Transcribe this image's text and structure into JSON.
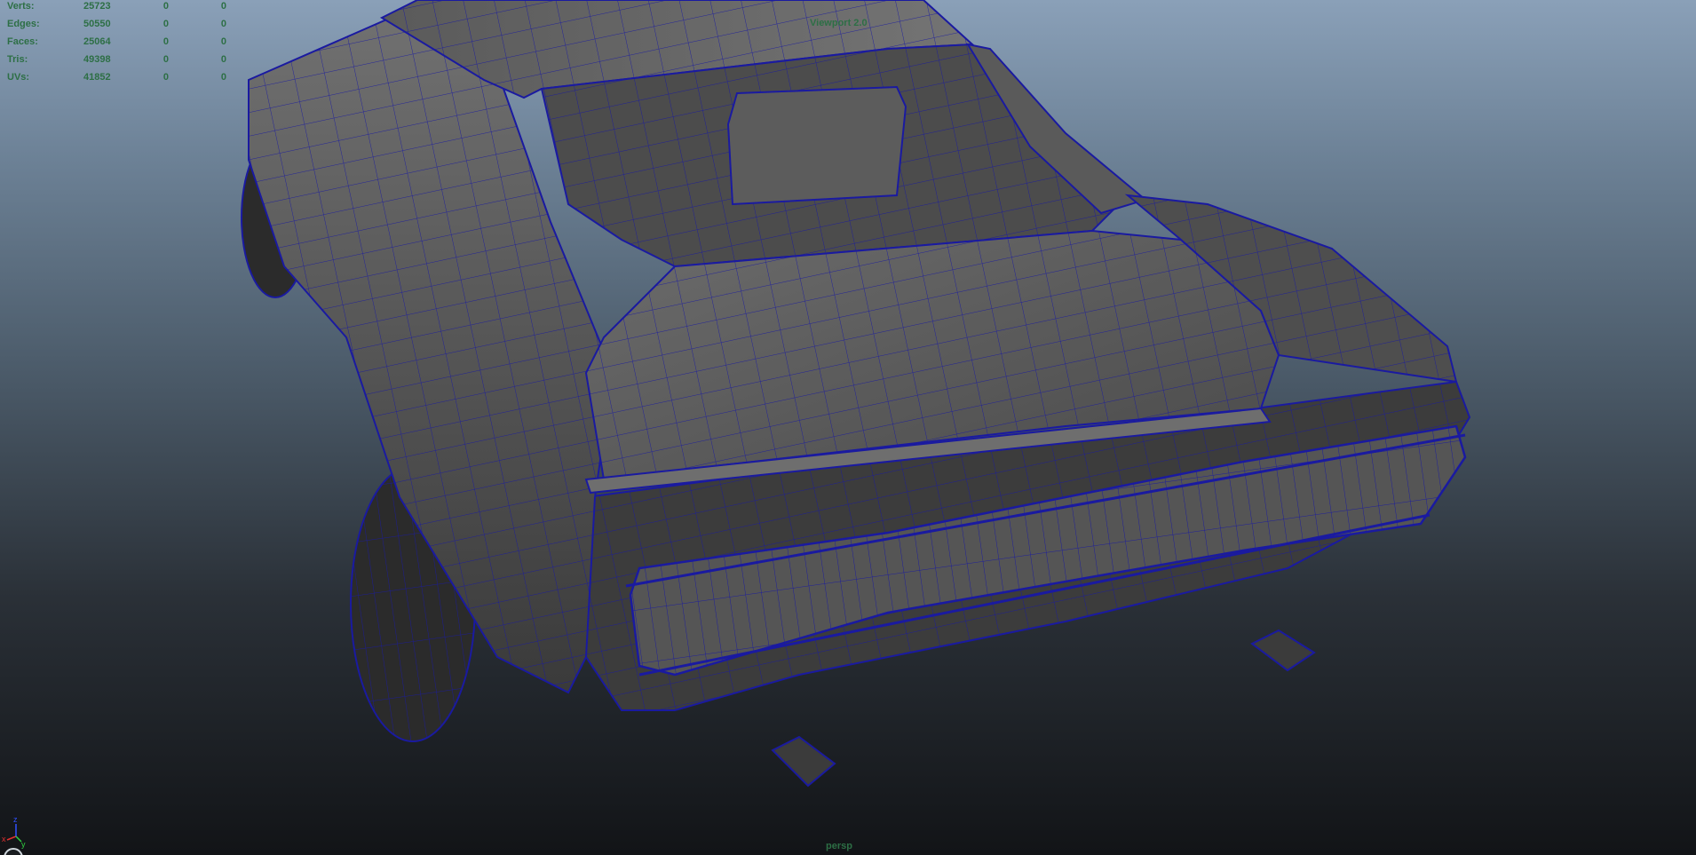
{
  "hud": {
    "rows": [
      {
        "label": "Verts:",
        "values": [
          "25723",
          "0",
          "0"
        ]
      },
      {
        "label": "Edges:",
        "values": [
          "50550",
          "0",
          "0"
        ]
      },
      {
        "label": "Faces:",
        "values": [
          "25064",
          "0",
          "0"
        ]
      },
      {
        "label": "Tris:",
        "values": [
          "49398",
          "0",
          "0"
        ]
      },
      {
        "label": "UVs:",
        "values": [
          "41852",
          "0",
          "0"
        ]
      }
    ]
  },
  "viewport": {
    "title": "Viewport 2.0",
    "camera": "persp"
  },
  "axes": {
    "x": "x",
    "y": "y",
    "z": "z"
  },
  "colors": {
    "wireframe": "#1a1aa0",
    "hud_text": "#2d6f45",
    "surface_light": "#6a6a6a",
    "surface_mid": "#545454",
    "surface_dark": "#3d3d3d"
  }
}
